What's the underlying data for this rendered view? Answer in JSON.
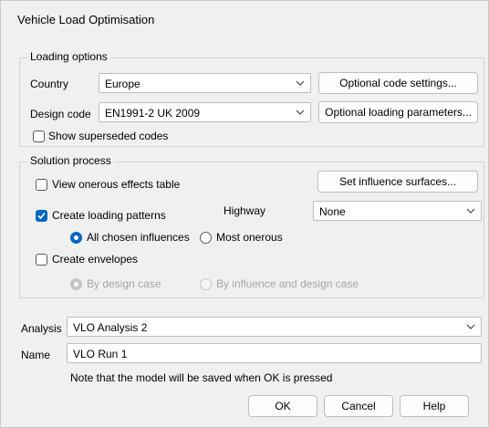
{
  "window": {
    "title": "Vehicle Load Optimisation"
  },
  "loading_options": {
    "caption": "Loading options",
    "country_label": "Country",
    "country_value": "Europe",
    "design_code_label": "Design code",
    "design_code_value": "EN1991-2 UK 2009",
    "optional_code_settings_label": "Optional code settings...",
    "optional_loading_parameters_label": "Optional loading parameters...",
    "show_superseded_label": "Show superseded codes",
    "show_superseded_checked": false
  },
  "solution_process": {
    "caption": "Solution process",
    "view_onerous_label": "View onerous effects table",
    "view_onerous_checked": false,
    "set_influence_label": "Set influence surfaces...",
    "create_loading_patterns_label": "Create loading patterns",
    "create_loading_patterns_checked": true,
    "highway_label": "Highway",
    "highway_value": "None",
    "all_chosen_influences_label": "All chosen influences",
    "most_onerous_label": "Most onerous",
    "pattern_selected": "All chosen influences",
    "create_envelopes_label": "Create envelopes",
    "create_envelopes_checked": false,
    "by_design_case_label": "By design case",
    "by_influence_label": "By influence and design case",
    "envelope_selected": "By design case"
  },
  "analysis": {
    "label": "Analysis",
    "value": "VLO Analysis 2"
  },
  "name": {
    "label": "Name",
    "value": "VLO Run 1"
  },
  "note": "Note that the model will be saved when OK is pressed",
  "buttons": {
    "ok": "OK",
    "cancel": "Cancel",
    "help": "Help"
  },
  "colors": {
    "accent": "#0067c0",
    "background": "#f0f0f0"
  }
}
